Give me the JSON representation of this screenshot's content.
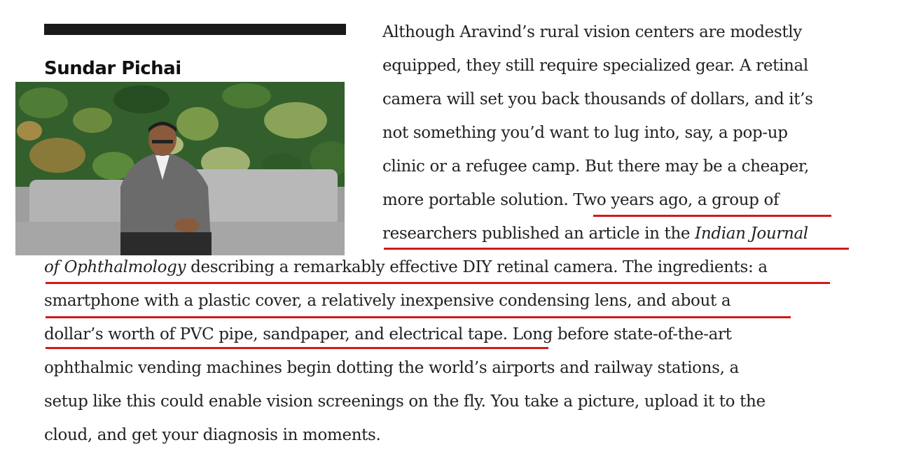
{
  "sidebar": {
    "caption_name": "Sundar Pichai",
    "photo_icon": "portrait-photo"
  },
  "article": {
    "l1": "Although Aravind’s rural vision centers are modestly",
    "l2": "equipped, they still require specialized gear. A retinal",
    "l3": "camera will set you back thousands of dollars, and it’s",
    "l4": "not something you’d want to lug into, say, a pop-up",
    "l5": "clinic or a refugee camp. But there may be a cheaper,",
    "l6a": "more portable solution. ",
    "l6b": "Two years ago, a group of",
    "l7a": "researchers published an article in the ",
    "l7b": "Indian Journal",
    "l8a": "of Ophthalmology",
    "l8b": " describing a remarkably effective DIY retinal camera. The ingredients: a",
    "l9": "smartphone with a plastic cover, a relatively inexpensive condensing lens, and about a",
    "l10a": "dollar’s worth of PVC pipe, sandpaper, and electrical tape.",
    "l10b": " Long before state-of-the-art",
    "l11": "ophthalmic vending machines begin dotting the world’s airports and railway stations, a",
    "l12": "setup like this could enable vision screenings on the fly. You take a picture, upload it to the",
    "l13": "cloud, and get your diagnosis in moments."
  },
  "colors": {
    "underline": "#d11a1a",
    "text": "#222222"
  }
}
